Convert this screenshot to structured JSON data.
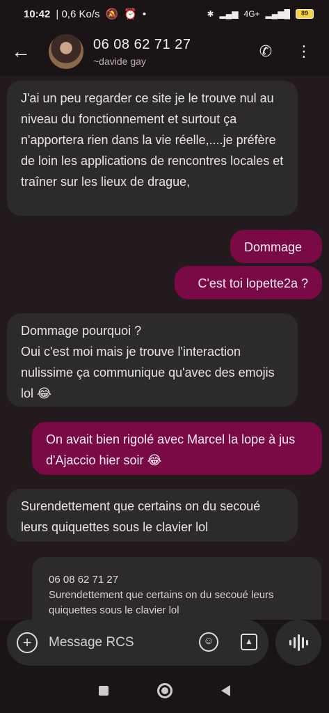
{
  "status": {
    "time": "10:42",
    "speed": "0,6 Ko/s",
    "network": "4G+",
    "battery": "89"
  },
  "header": {
    "contact_number": "06 08 62 71 27",
    "contact_name": "~davide gay"
  },
  "messages": [
    {
      "direction": "in",
      "text": "J'ai un peu regarder ce site je le trouve nul au niveau du fonctionnement et surtout ça n'apportera rien dans la vie réelle,....je préfère de loin les applications de rencontres locales et traîner sur les lieux de drague,"
    },
    {
      "direction": "out",
      "text": "Dommage"
    },
    {
      "direction": "out",
      "text": "C'est toi lopette2a ?"
    },
    {
      "direction": "in",
      "text": "Dommage pourquoi ?\nOui c'est moi mais je trouve l'interaction nulissime ça communique qu'avec des emojis lol 😂"
    },
    {
      "direction": "out",
      "text": "On avait bien rigolé avec Marcel la lope à jus d'Ajaccio hier soir 😂"
    },
    {
      "direction": "in",
      "text": "Surendettement que certains on du secoué leurs quiquettes sous le clavier lol"
    }
  ],
  "quote": {
    "number": "06 08 62 71 27",
    "text": "Surendettement que certains on du secoué leurs quiquettes sous le clavier lol"
  },
  "compose": {
    "placeholder": "Message RCS"
  },
  "icons": {
    "back": "arrow-left-icon",
    "call": "phone-icon",
    "more": "more-vert-icon",
    "add": "plus-circle-icon",
    "emoji": "emoji-icon",
    "gallery": "image-icon",
    "voice": "waveform-icon"
  },
  "colors": {
    "outgoing_bubble": "#7a0a46",
    "incoming_bubble": "#2c2a2c"
  }
}
